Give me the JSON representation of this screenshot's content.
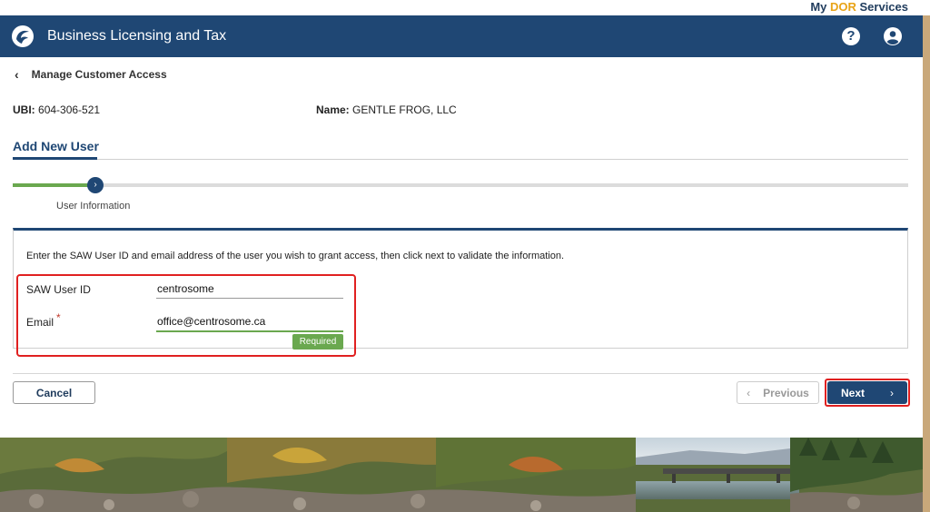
{
  "top_link": {
    "prefix": "My ",
    "dor": "DOR",
    "suffix": " Services"
  },
  "header": {
    "title": "Business Licensing and Tax",
    "help_glyph": "?"
  },
  "nav": {
    "back_label": "Manage Customer Access",
    "back_glyph": "‹"
  },
  "account": {
    "ubi_label": "UBI:",
    "ubi_value": "604-306-521",
    "name_label": "Name:",
    "name_value": "GENTLE FROG, LLC"
  },
  "section": {
    "title": "Add New User"
  },
  "stepper": {
    "step_label": "User Information",
    "step_glyph": "›",
    "progress": 0.085
  },
  "form": {
    "instructions": "Enter the SAW User ID and email address of the user you wish to grant access, then click next to validate the information.",
    "saw_label": "SAW User ID",
    "saw_value": "centrosome",
    "email_label": "Email",
    "email_required_mark": "*",
    "email_value": "office@centrosome.ca",
    "required_badge": "Required"
  },
  "buttons": {
    "cancel": "Cancel",
    "previous": "Previous",
    "next": "Next",
    "prev_glyph": "‹",
    "next_glyph": "›"
  },
  "icons": {
    "logo": "brand-logo-icon",
    "help": "help-icon",
    "user": "user-account-icon"
  },
  "colors": {
    "header_bg": "#1f4774",
    "accent_green": "#6aa84f",
    "highlight_red": "#e02020",
    "dor_orange": "#e8a317"
  }
}
